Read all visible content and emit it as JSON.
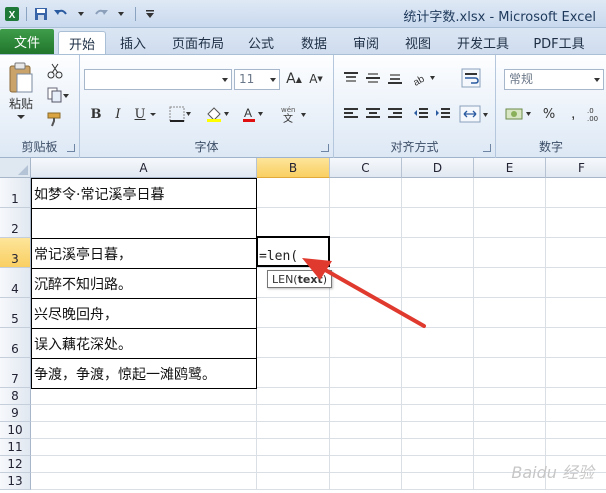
{
  "window": {
    "title": "统计字数.xlsx - Microsoft Excel"
  },
  "ribbon_tabs": [
    "文件",
    "开始",
    "插入",
    "页面布局",
    "公式",
    "数据",
    "审阅",
    "视图",
    "开发工具",
    "PDF工具"
  ],
  "active_tab": "开始",
  "ribbon": {
    "clipboard": {
      "paste_label": "粘贴",
      "group_label": "剪贴板"
    },
    "font": {
      "font_name": "",
      "font_size": "11",
      "bold": "B",
      "italic": "I",
      "underline": "U",
      "group_label": "字体"
    },
    "alignment": {
      "group_label": "对齐方式"
    },
    "number": {
      "format": "常规",
      "percent": "%",
      "group_label": "数字"
    }
  },
  "columns": [
    "A",
    "B",
    "C",
    "D",
    "E",
    "F"
  ],
  "selected_column": "B",
  "rows": [
    "1",
    "2",
    "3",
    "4",
    "5",
    "6",
    "7",
    "8",
    "9",
    "10",
    "11",
    "12",
    "13"
  ],
  "selected_row": "3",
  "cells_a": [
    "如梦令·常记溪亭日暮",
    "",
    "常记溪亭日暮，",
    "沉醉不知归路。",
    "兴尽晚回舟，",
    "误入藕花深处。",
    "争渡，争渡，惊起一滩鸥鹭。"
  ],
  "active_cell": {
    "ref": "B3",
    "formula": "=len("
  },
  "tooltip": {
    "func": "LEN(",
    "arg": "text",
    "close": ")"
  },
  "watermark": "Baidu 经验",
  "colors": {
    "file_tab": "#2e8b3a",
    "selection": "#f9cf62",
    "arrow": "#e03a2e"
  }
}
